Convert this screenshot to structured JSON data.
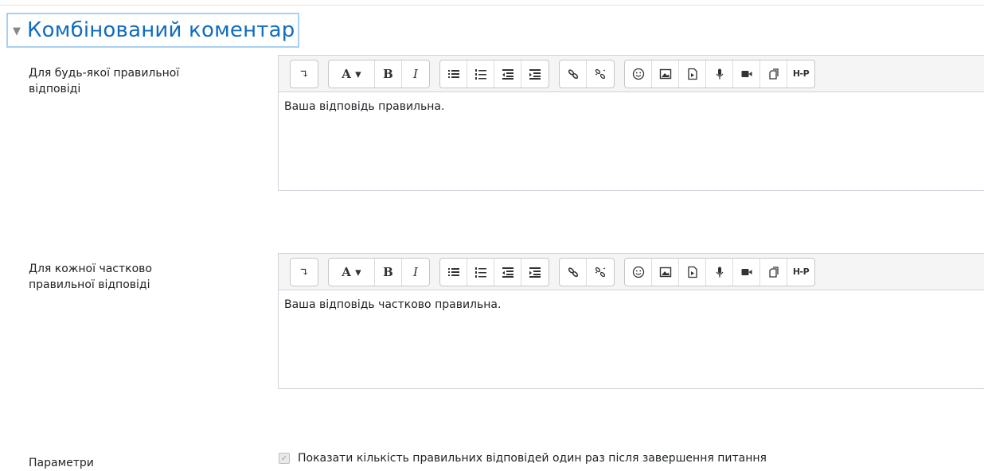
{
  "section": {
    "title": "Комбінований коментар"
  },
  "toolbar_buttons": {
    "align": "↴",
    "font": "A ▾",
    "bold": "B",
    "italic": "I",
    "h5p": "H-P"
  },
  "fields": [
    {
      "label": "Для будь-якої правильної відповіді",
      "content": "Ваша відповідь правильна."
    },
    {
      "label": "Для кожної частково правильної відповіді",
      "content": "Ваша відповідь частково правильна."
    }
  ],
  "params": {
    "label": "Параметри",
    "checkbox_label": "Показати кількість правильних відповідей один раз після завершення питання",
    "checked": true
  }
}
